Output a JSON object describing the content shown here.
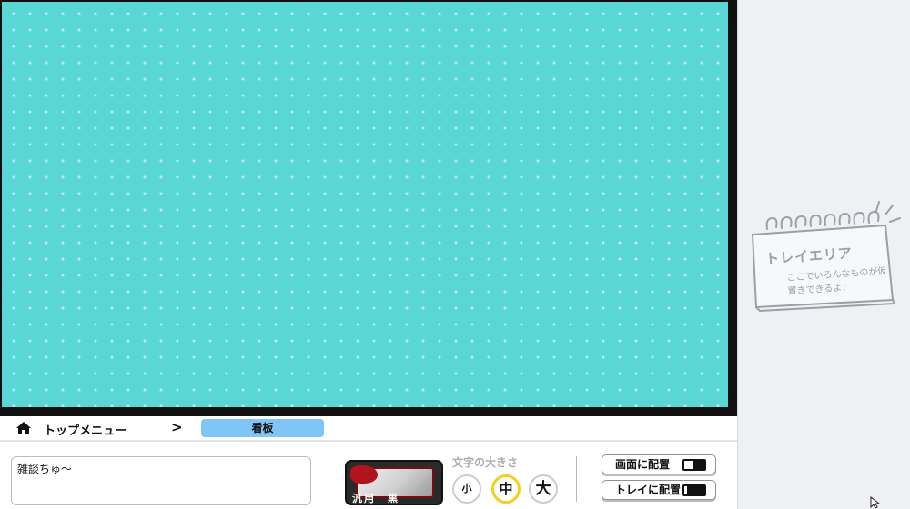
{
  "breadcrumb": {
    "home_label": "トップメニュー",
    "separator": ">",
    "current_tab": "看板"
  },
  "editor": {
    "text_value": "雑談ちゅ〜",
    "style_label": "汎用　黒"
  },
  "font_size": {
    "label": "文字の大きさ",
    "options": [
      "小",
      "中",
      "大"
    ],
    "selected": "中"
  },
  "actions": {
    "place_screen": "画面に配置",
    "place_tray": "トレイに配置"
  },
  "tray": {
    "title": "トレイエリア",
    "subtitle": "ここでいろんなものが仮置きできるよ！"
  },
  "colors": {
    "canvas_bg": "#5ad6d4",
    "tab_active": "#7fc6f7",
    "size_selected_border": "#f3cf1e",
    "tray_bg": "#eef0f4"
  },
  "icons": [
    "home-icon",
    "chevron-right-icon",
    "screen-place-icon",
    "tray-place-icon",
    "cursor-icon"
  ]
}
